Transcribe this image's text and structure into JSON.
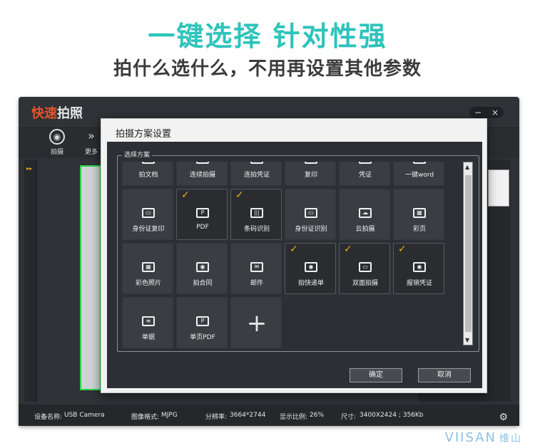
{
  "banner": {
    "headline": "一键选择 针对性强",
    "subline": "拍什么选什么，不用再设置其他参数"
  },
  "app": {
    "title_part1": "快速",
    "title_part2": "拍照",
    "window_buttons": [
      "−",
      "×"
    ],
    "toolbar": [
      {
        "label": "拍摄",
        "icon": "camera-icon"
      },
      {
        "label": "更多",
        "icon": "double-chevron-right-icon"
      }
    ]
  },
  "dialog": {
    "title": "拍摄方案设置",
    "group_label": "选择方案",
    "items": [
      {
        "label": "拍文档",
        "icon": "document-icon",
        "selected": false
      },
      {
        "label": "连续拍摄",
        "icon": "camera-icon",
        "selected": false
      },
      {
        "label": "连拍凭证",
        "icon": "camera-icon",
        "selected": false
      },
      {
        "label": "复印",
        "icon": "copy-icon",
        "selected": false
      },
      {
        "label": "凭证",
        "icon": "camera-icon",
        "selected": false
      },
      {
        "label": "一键word",
        "icon": "camera-icon",
        "selected": false
      },
      {
        "label": "身份证复印",
        "icon": "id-card-icon",
        "selected": false
      },
      {
        "label": "PDF",
        "icon": "pdf-icon",
        "selected": true
      },
      {
        "label": "条码识别",
        "icon": "barcode-icon",
        "selected": true
      },
      {
        "label": "身份证识别",
        "icon": "id-card-scan-icon",
        "selected": false
      },
      {
        "label": "云拍摄",
        "icon": "cloud-camera-icon",
        "selected": false
      },
      {
        "label": "彩页",
        "icon": "color-page-icon",
        "selected": false
      },
      {
        "label": "彩色照片",
        "icon": "color-photo-icon",
        "selected": false
      },
      {
        "label": "拍合同",
        "icon": "camera-icon",
        "selected": false
      },
      {
        "label": "邮件",
        "icon": "mail-icon",
        "selected": false
      },
      {
        "label": "拍快递单",
        "icon": "camera-icon",
        "selected": true
      },
      {
        "label": "双面拍摄",
        "icon": "id-card-icon",
        "selected": true
      },
      {
        "label": "报销凭证",
        "icon": "camera-icon",
        "selected": true
      },
      {
        "label": "单据",
        "icon": "receipt-icon",
        "selected": false
      },
      {
        "label": "单页PDF",
        "icon": "pdf-icon",
        "selected": false
      }
    ],
    "add_label": "+",
    "ok_label": "确定",
    "cancel_label": "取消"
  },
  "status": {
    "device_label": "设备名称:",
    "device_value": "USB Camera",
    "format_label": "图像格式:",
    "format_value": "MJPG",
    "resolution_label": "分辨率:",
    "resolution_value": "3664*2744",
    "ratio_label": "显示比例:",
    "ratio_value": "26%",
    "size_label": "尺寸:",
    "size_value": "3400X2424 ; 356Kb"
  },
  "brand": {
    "logo_text": "VIISAN",
    "logo_cn": "维山"
  }
}
